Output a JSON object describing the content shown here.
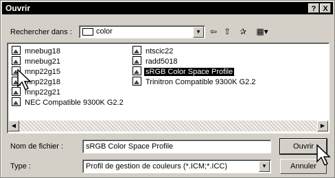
{
  "window": {
    "title": "Ouvrir",
    "help_btn": "?",
    "close_btn": "X"
  },
  "look_in": {
    "label": "Rechercher dans :",
    "value": "color"
  },
  "files": [
    {
      "name": "mnebug18",
      "selected": false
    },
    {
      "name": "mnebug21",
      "selected": false
    },
    {
      "name": "mnp22g15",
      "selected": false
    },
    {
      "name": "mnp22g18",
      "selected": false
    },
    {
      "name": "mnp22g21",
      "selected": false
    },
    {
      "name": "NEC Compatible 9300K G2.2",
      "selected": false
    },
    {
      "name": "ntscic22",
      "selected": false
    },
    {
      "name": "radd5018",
      "selected": false
    },
    {
      "name": "sRGB Color Space Profile",
      "selected": true
    },
    {
      "name": "Trinitron Compatible 9300K G2.2",
      "selected": false
    }
  ],
  "filename": {
    "label": "Nom de fichier :",
    "value": "sRGB Color Space Profile"
  },
  "filetype": {
    "label": "Type :",
    "value": "Profil de gestion de couleurs (*.ICM;*.ICC)"
  },
  "buttons": {
    "open": "Ouvrir",
    "cancel": "Annuler"
  }
}
